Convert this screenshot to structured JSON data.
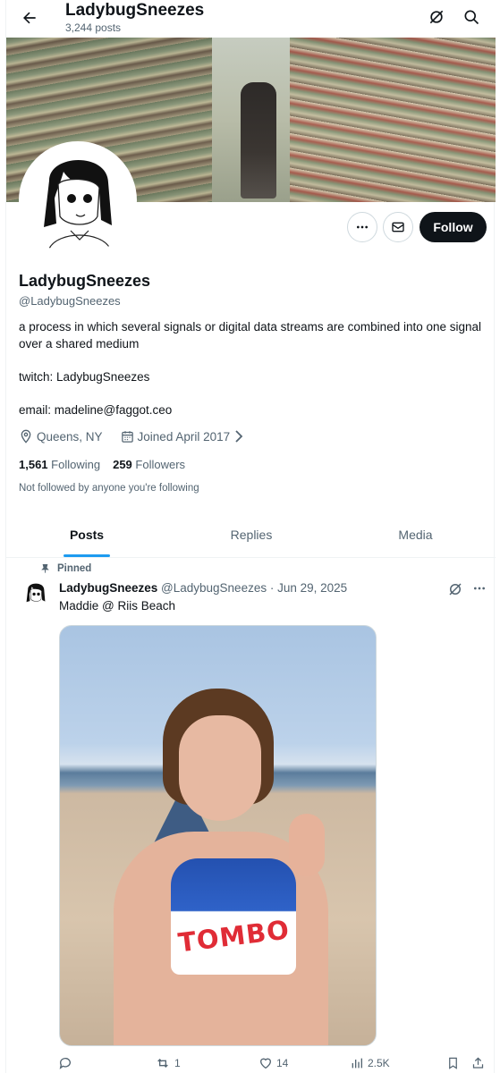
{
  "header": {
    "title": "LadybugSneezes",
    "post_count": "3,244 posts",
    "back_icon": "arrow-left-icon",
    "grok_icon": "grok-icon",
    "search_icon": "search-icon"
  },
  "profile": {
    "display_name": "LadybugSneezes",
    "handle": "@LadybugSneezes",
    "bio": "a process in which several signals or digital data streams are combined into one signal over a shared medium\n\ntwitch: LadybugSneezes\n\nemail: madeline@faggot.ceo",
    "location": "Queens, NY",
    "joined": "Joined April 2017",
    "following_count": "1,561",
    "following_label": "Following",
    "followers_count": "259",
    "followers_label": "Followers",
    "not_followed_text": "Not followed by anyone you're following",
    "follow_label": "Follow"
  },
  "tabs": [
    {
      "label": "Posts",
      "active": true
    },
    {
      "label": "Replies",
      "active": false
    },
    {
      "label": "Media",
      "active": false
    }
  ],
  "post": {
    "pinned_label": "Pinned",
    "author_name": "LadybugSneezes",
    "author_handle": "@LadybugSneezes",
    "date": "· Jun 29, 2025",
    "text": "Maddie @ Riis Beach",
    "image_shirt_text": "TOMBO",
    "reply_count": "",
    "repost_count": "1",
    "like_count": "14",
    "view_count": "2.5K"
  },
  "colors": {
    "text": "#0f1419",
    "muted": "#536471",
    "accent": "#1d9bf0",
    "border": "#cfd9de"
  }
}
